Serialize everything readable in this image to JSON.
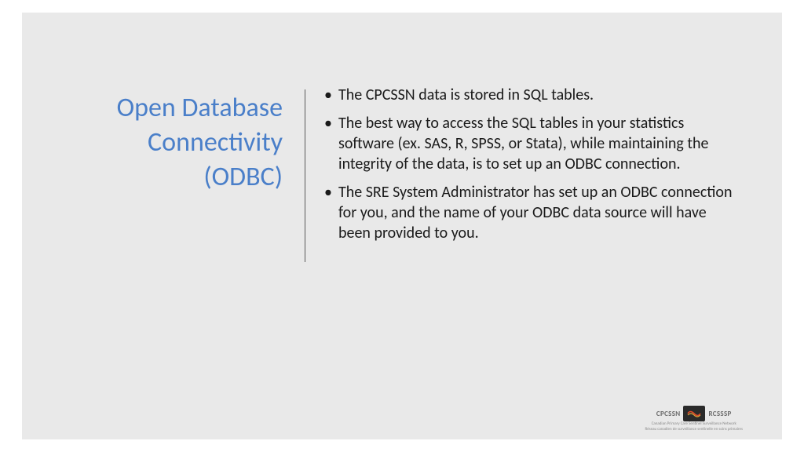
{
  "title": "Open Database Connectivity (ODBC)",
  "bullets": [
    "The CPCSSN data is stored in SQL tables.",
    "The best way to access the SQL tables in your statistics software (ex. SAS, R, SPSS, or Stata), while maintaining the integrity of the data, is to set up an ODBC connection.",
    "The SRE System Administrator has set up an ODBC connection for you, and the name of your ODBC data source will have been provided to you."
  ],
  "footer": {
    "left_acronym": "CPCSSN",
    "right_acronym": "RCSSSP",
    "subtitle_line1": "Canadian Primary Care Sentinel Surveillance Network",
    "subtitle_line2": "Réseau canadien de surveillance sentinelle en soins primaires"
  }
}
